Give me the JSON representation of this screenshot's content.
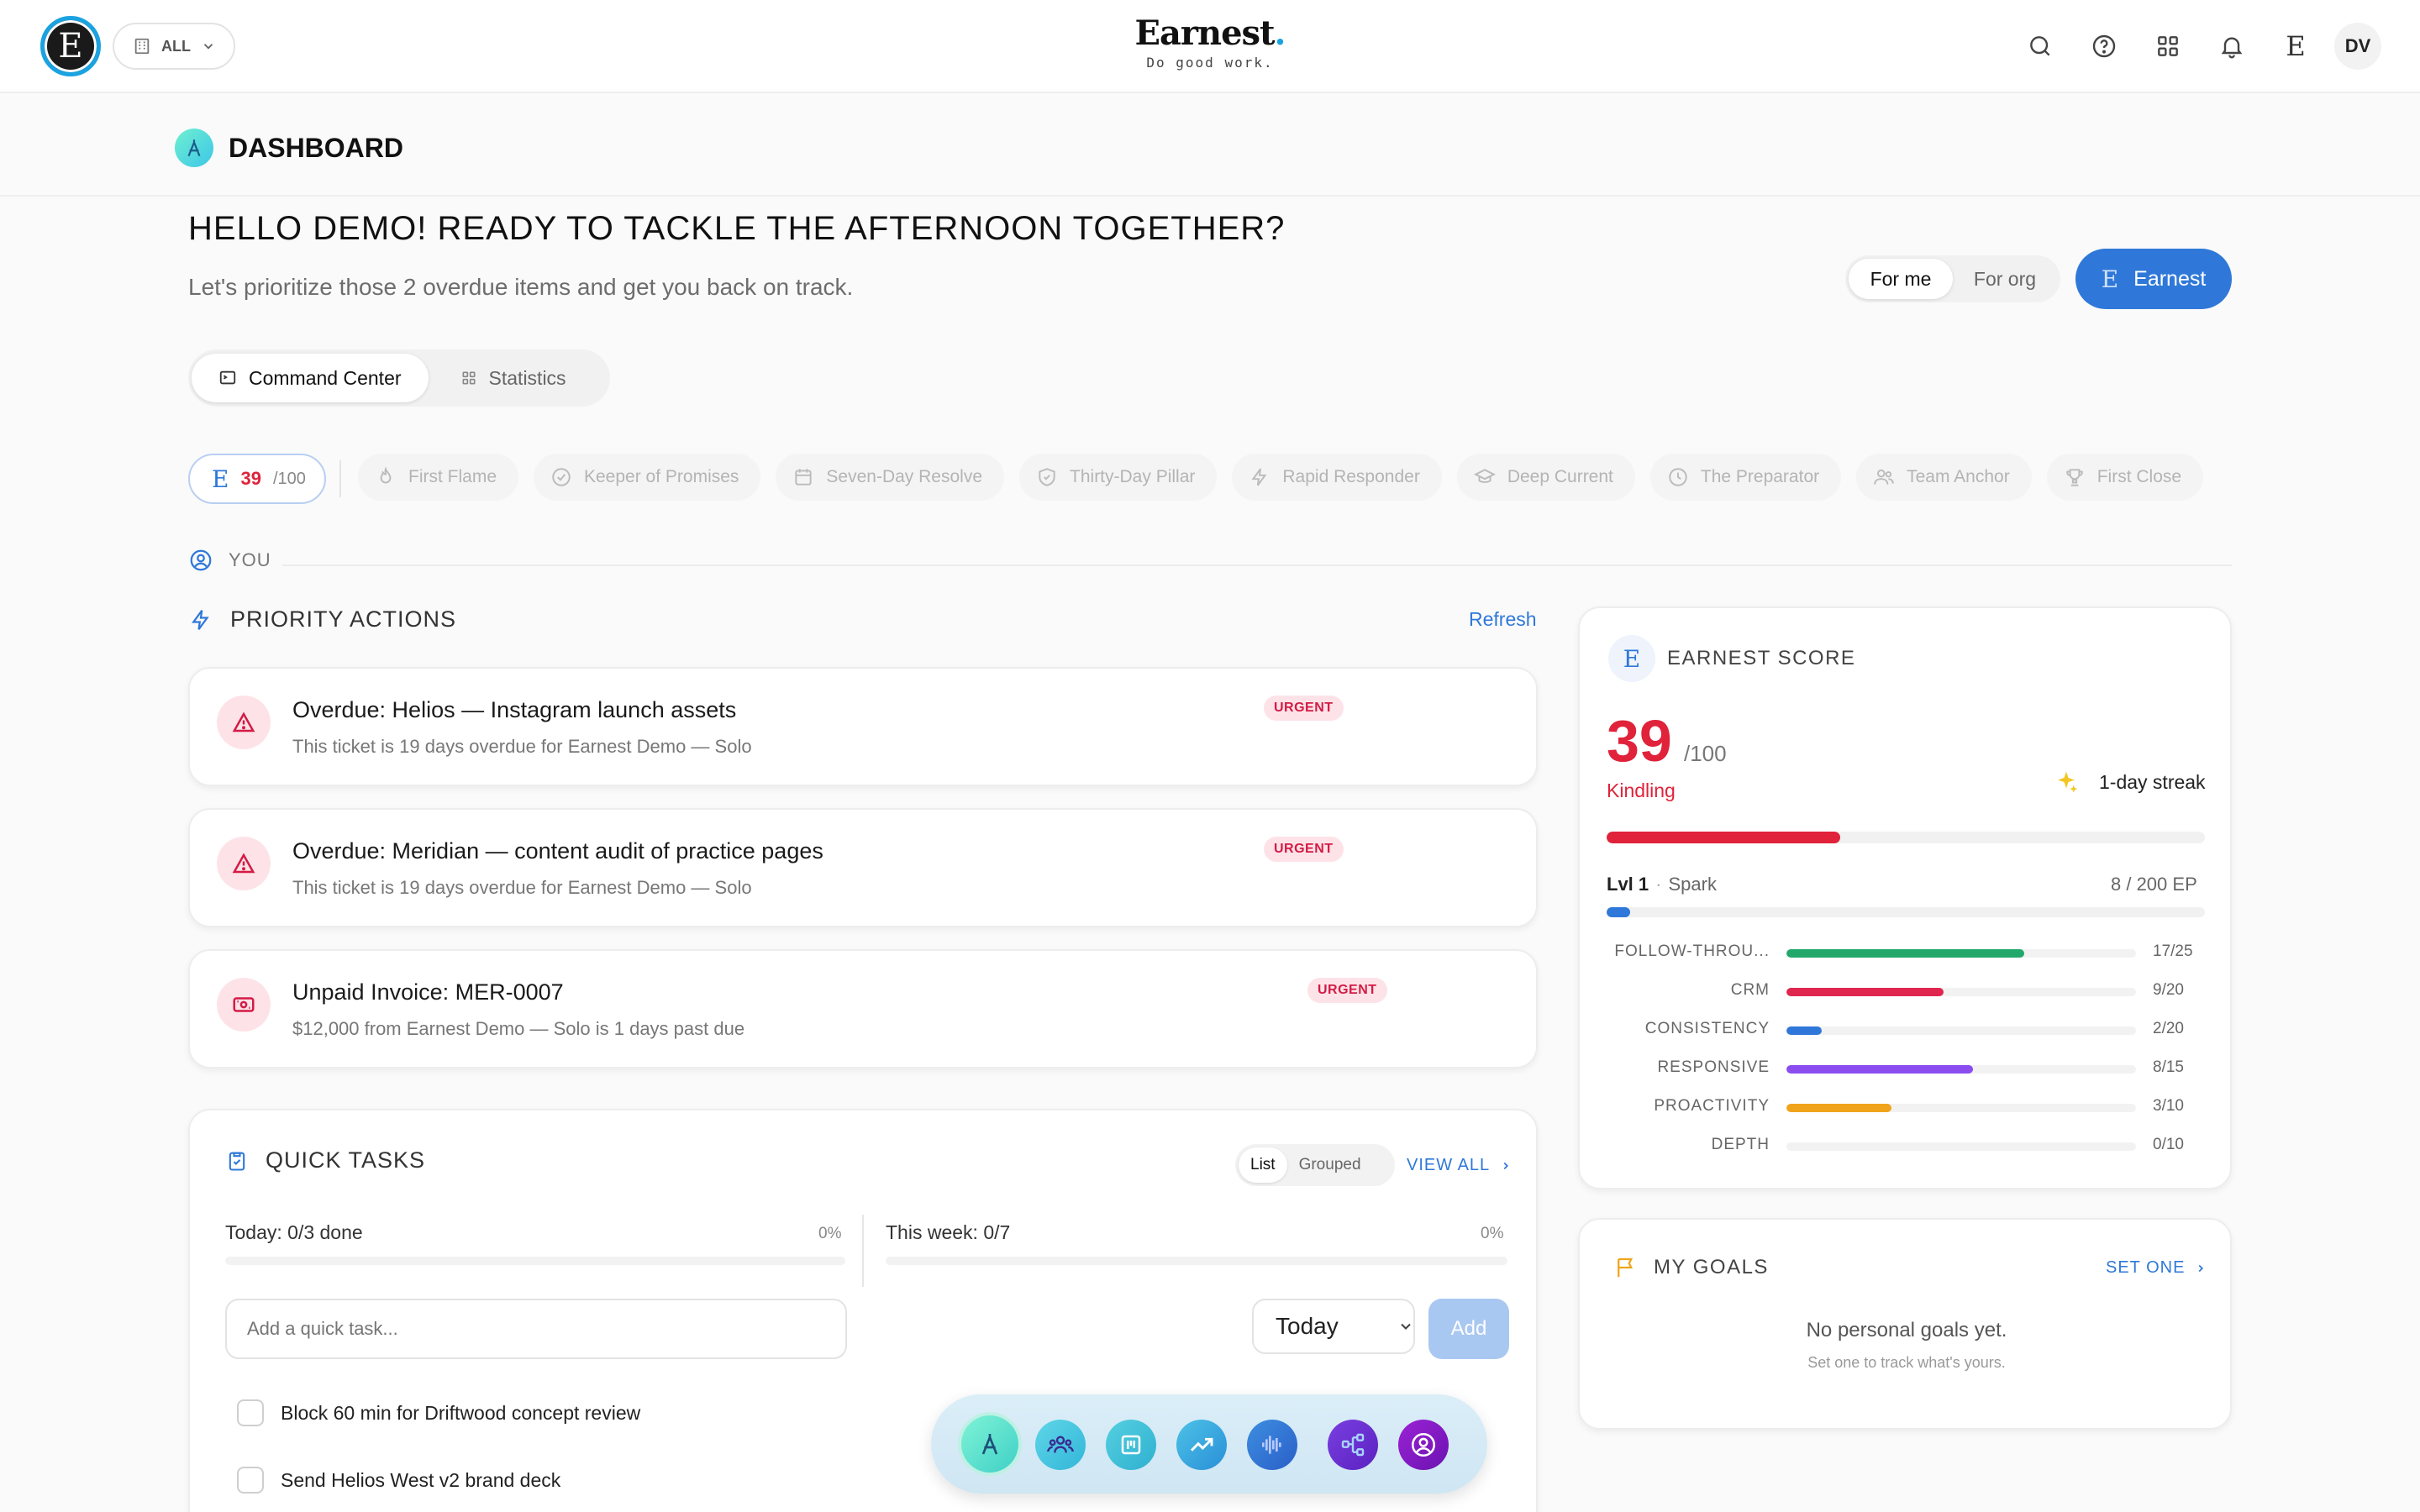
{
  "topbar": {
    "logo_letter": "E",
    "scope_label": "ALL",
    "brand_name": "Earnest",
    "brand_tagline": "Do good work.",
    "avatar_initials": "DV",
    "icons": [
      "search-icon",
      "help-icon",
      "apps-grid-icon",
      "bell-icon",
      "earnest-e-icon"
    ]
  },
  "page": {
    "title": "DASHBOARD",
    "greeting": "HELLO DEMO! READY TO TACKLE THE AFTERNOON TOGETHER?",
    "subgreeting": "Let's prioritize those 2 overdue items and get you back on track.",
    "audience_toggle": {
      "for_me": "For me",
      "for_org": "For org",
      "selected": "For me"
    },
    "earnest_button": "Earnest"
  },
  "tabs": [
    {
      "label": "Command Center",
      "active": true
    },
    {
      "label": "Statistics",
      "active": false
    }
  ],
  "badges": {
    "score_value": "39",
    "score_max": "/100",
    "items": [
      {
        "label": "First Flame",
        "icon": "flame-icon"
      },
      {
        "label": "Keeper of Promises",
        "icon": "check-circle-icon"
      },
      {
        "label": "Seven-Day Resolve",
        "icon": "calendar-icon"
      },
      {
        "label": "Thirty-Day Pillar",
        "icon": "shield-check-icon"
      },
      {
        "label": "Rapid Responder",
        "icon": "bolt-icon"
      },
      {
        "label": "Deep Current",
        "icon": "graduation-cap-icon"
      },
      {
        "label": "The Preparator",
        "icon": "clock-icon"
      },
      {
        "label": "Team Anchor",
        "icon": "users-icon"
      },
      {
        "label": "First Close",
        "icon": "trophy-icon"
      }
    ]
  },
  "you_label": "YOU",
  "priority": {
    "title": "PRIORITY ACTIONS",
    "refresh_label": "Refresh",
    "items": [
      {
        "title": "Overdue: Helios — Instagram launch assets",
        "subtitle": "This ticket is 19 days overdue for Earnest Demo — Solo",
        "tag": "URGENT",
        "icon": "warning-triangle-icon"
      },
      {
        "title": "Overdue: Meridian — content audit of practice pages",
        "subtitle": "This ticket is 19 days overdue for Earnest Demo — Solo",
        "tag": "URGENT",
        "icon": "warning-triangle-icon"
      },
      {
        "title": "Unpaid Invoice: MER-0007",
        "subtitle": "$12,000 from Earnest Demo — Solo is 1 days past due",
        "tag": "URGENT",
        "icon": "invoice-money-icon"
      }
    ]
  },
  "quick_tasks": {
    "title": "QUICK TASKS",
    "view_list": "List",
    "view_grouped": "Grouped",
    "view_all": "VIEW ALL",
    "today_label": "Today: 0/3 done",
    "today_pct": "0%",
    "today_progress": 0,
    "week_label": "This week: 0/7",
    "week_pct": "0%",
    "week_progress": 0,
    "input_placeholder": "Add a quick task...",
    "when_value": "Today",
    "add_label": "Add",
    "tasks": [
      {
        "label": "Block 60 min for Driftwood concept review",
        "done": false
      },
      {
        "label": "Send Helios West v2 brand deck",
        "done": false
      }
    ]
  },
  "earnest_score": {
    "title": "EARNEST SCORE",
    "score": "39",
    "max": "/100",
    "level_name": "Kindling",
    "streak": "1-day streak",
    "score_fraction": 0.39,
    "lvl_label": "Lvl 1",
    "lvl_name": "Spark",
    "ep": "8 / 200 EP",
    "ep_fraction": 0.04,
    "metrics": [
      {
        "name": "FOLLOW-THROU...",
        "value": "17/25",
        "fraction": 0.68,
        "color": "#22a86b"
      },
      {
        "name": "CRM",
        "value": "9/20",
        "fraction": 0.45,
        "color": "#e0264f"
      },
      {
        "name": "CONSISTENCY",
        "value": "2/20",
        "fraction": 0.1,
        "color": "#2f78d9"
      },
      {
        "name": "RESPONSIVE",
        "value": "8/15",
        "fraction": 0.533,
        "color": "#8b4cf0"
      },
      {
        "name": "PROACTIVITY",
        "value": "3/10",
        "fraction": 0.3,
        "color": "#f0a41b"
      },
      {
        "name": "DEPTH",
        "value": "0/10",
        "fraction": 0.0,
        "color": "#999999"
      }
    ]
  },
  "goals": {
    "title": "MY GOALS",
    "set_one": "SET ONE",
    "empty": "No personal goals yet.",
    "hint": "Set one to track what's yours."
  },
  "dock": {
    "items": [
      "compass-icon",
      "team-icon",
      "board-icon",
      "trend-chart-icon",
      "audio-wave-icon",
      "workflow-icon",
      "profile-icon"
    ]
  },
  "colors": {
    "accent": "#2f78d9",
    "urgent": "#d41b45",
    "score_red": "#e0223a",
    "brand_ring": "#1ba2e0"
  }
}
